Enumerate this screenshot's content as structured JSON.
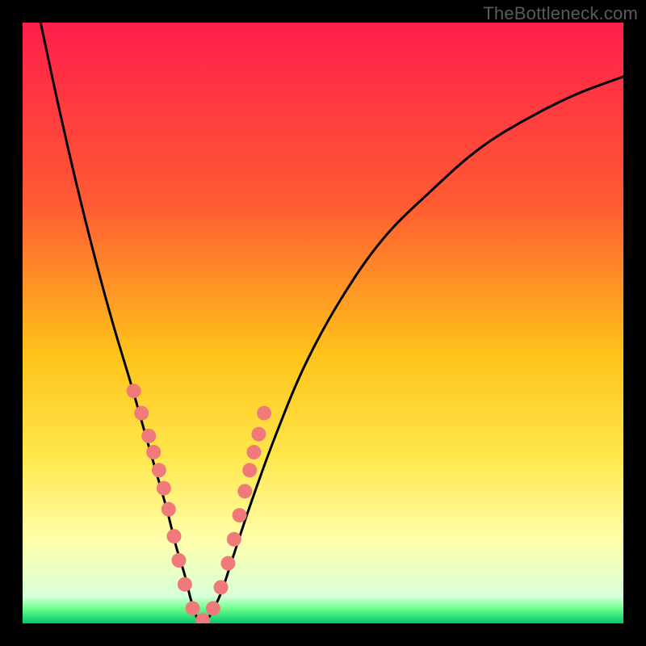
{
  "watermark": "TheBottleneck.com",
  "chart_data": {
    "type": "line",
    "title": "",
    "xlabel": "",
    "ylabel": "",
    "xlim": [
      0,
      100
    ],
    "ylim": [
      0,
      100
    ],
    "gradient_stops": [
      {
        "offset": 0.0,
        "color": "#ff1f4b"
      },
      {
        "offset": 0.3,
        "color": "#ff5a33"
      },
      {
        "offset": 0.55,
        "color": "#ffc21a"
      },
      {
        "offset": 0.72,
        "color": "#ffe64a"
      },
      {
        "offset": 0.86,
        "color": "#ffffaa"
      },
      {
        "offset": 0.955,
        "color": "#d8ffd8"
      },
      {
        "offset": 0.975,
        "color": "#6eff8c"
      },
      {
        "offset": 1.0,
        "color": "#00c86a"
      }
    ],
    "series": [
      {
        "name": "curve",
        "x": [
          3,
          6,
          9,
          12,
          15,
          18,
          20,
          22,
          24,
          25.5,
          27,
          28,
          29,
          30,
          31,
          33,
          35,
          38,
          42,
          47,
          53,
          60,
          68,
          76,
          84,
          92,
          100
        ],
        "y": [
          100,
          86,
          73,
          61,
          50,
          40,
          33,
          26,
          19,
          13,
          8,
          4,
          1,
          0,
          1,
          5,
          11,
          20,
          31,
          43,
          54,
          64,
          72,
          79,
          84,
          88,
          91
        ]
      }
    ],
    "markers": {
      "name": "dots",
      "color": "#f07a7a",
      "radius_px": 9,
      "x": [
        18.5,
        19.8,
        21.0,
        21.8,
        22.7,
        23.5,
        24.3,
        25.2,
        26.0,
        27.0,
        28.3,
        30.0,
        31.7,
        33.0,
        34.2,
        35.2,
        36.1,
        37.0,
        37.8,
        38.5,
        39.3,
        40.2
      ],
      "y": [
        38.7,
        35.0,
        31.2,
        28.5,
        25.5,
        22.5,
        19.0,
        14.5,
        10.5,
        6.5,
        2.5,
        0.5,
        2.5,
        6.0,
        10.0,
        14.0,
        18.0,
        22.0,
        25.5,
        28.5,
        31.5,
        35.0
      ]
    }
  }
}
